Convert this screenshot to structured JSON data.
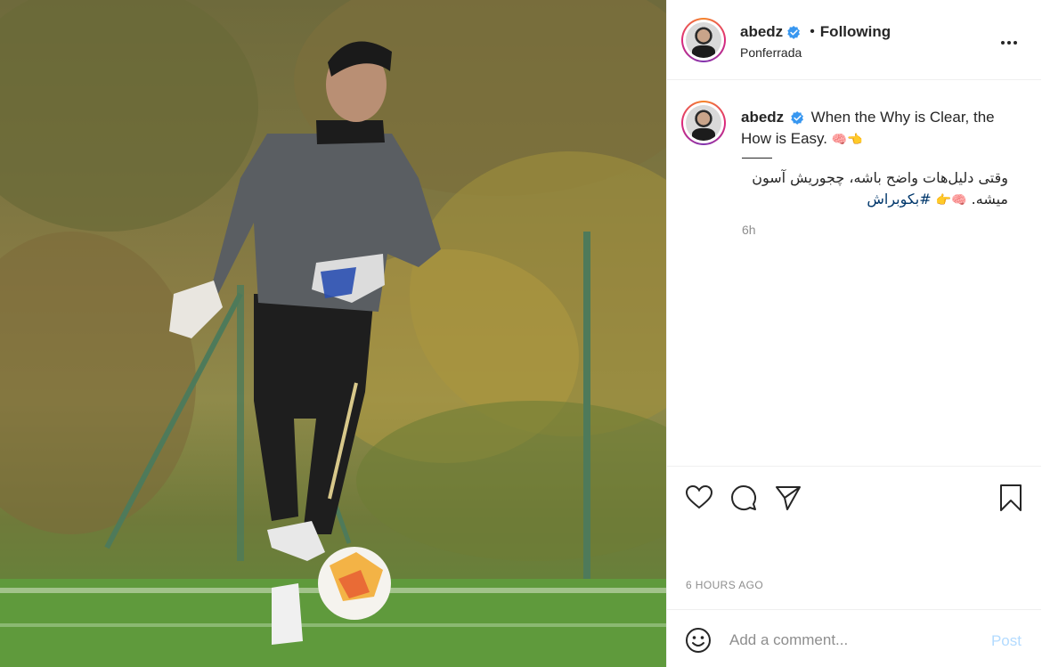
{
  "post": {
    "image_alt": "Goalkeeper in grey training top kicking a football on a grass pitch",
    "header": {
      "username": "abedz",
      "separator": "•",
      "follow_status": "Following",
      "location": "Ponferrada",
      "more_label": "..."
    },
    "caption": {
      "username": "abedz",
      "text_en": "When the Why is Clear, the How is Easy.",
      "emoji_en": "🧠👈",
      "text_fa": "وقتی دلیل‌هات واضح باشه، چجوریش آسون میشه.",
      "emoji_fa": "🧠👉",
      "hashtag": "#بکوبراش",
      "time_short": "6h"
    },
    "timestamp": "6 HOURS AGO",
    "comment": {
      "placeholder": "Add a comment...",
      "post_label": "Post"
    }
  },
  "colors": {
    "link": "#00376b",
    "muted": "#8e8e8e",
    "post_disabled": "#b3dbff",
    "verified": "#3897f0"
  },
  "icons": [
    "heart-icon",
    "comment-icon",
    "share-icon",
    "bookmark-icon",
    "smiley-icon",
    "verified-badge-icon",
    "more-options-icon"
  ]
}
